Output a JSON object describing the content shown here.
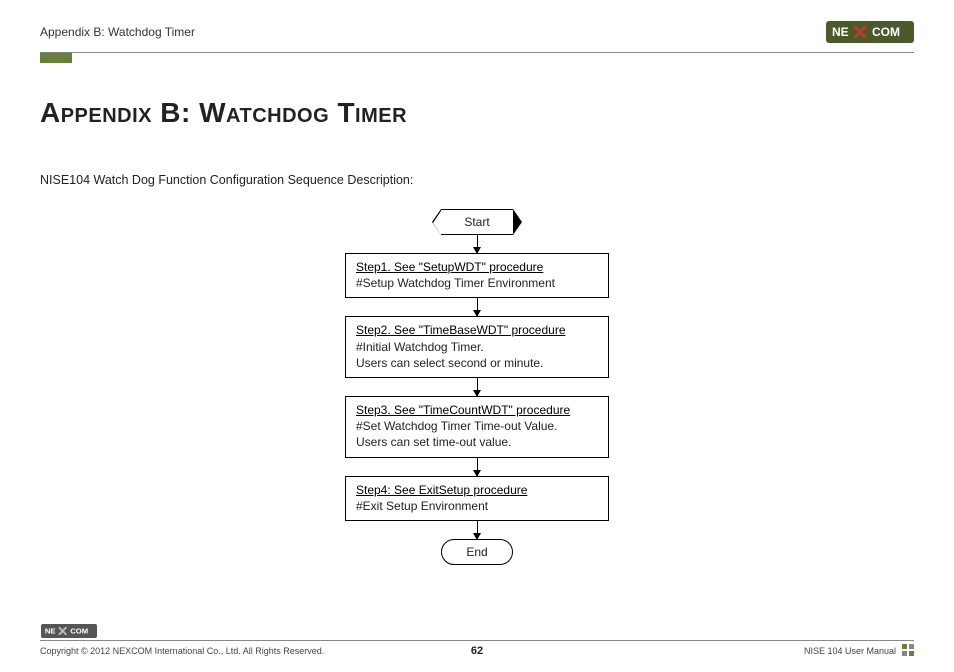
{
  "header": {
    "breadcrumb": "Appendix B: Watchdog Timer",
    "logo_text_left": "NE",
    "logo_text_right": "COM"
  },
  "title": "Appendix B: Watchdog Timer",
  "intro": "NISE104 Watch Dog Function Configuration Sequence Description:",
  "flow": {
    "start": "Start",
    "end": "End",
    "steps": [
      {
        "link": "Step1. See \"SetupWDT\" procedure",
        "desc": "#Setup Watchdog Timer Environment"
      },
      {
        "link": "Step2. See \"TimeBaseWDT\" procedure",
        "desc": "#Initial Watchdog Timer.\n Users can select second or minute."
      },
      {
        "link": "Step3. See \"TimeCountWDT\" procedure",
        "desc": "#Set Watchdog Timer Time-out Value.\nUsers can set time-out value."
      },
      {
        "link": "Step4: See ExitSetup procedure",
        "desc": "#Exit Setup Environment"
      }
    ]
  },
  "footer": {
    "copyright": "Copyright © 2012 NEXCOM International Co., Ltd. All Rights Reserved.",
    "page_number": "62",
    "manual": "NISE 104 User Manual"
  },
  "chart_data": {
    "type": "flowchart",
    "direction": "top-to-bottom",
    "nodes": [
      {
        "id": "start",
        "shape": "terminator-hex",
        "label": "Start"
      },
      {
        "id": "s1",
        "shape": "process",
        "title": "Step1. See \"SetupWDT\" procedure",
        "body": "#Setup Watchdog Timer Environment"
      },
      {
        "id": "s2",
        "shape": "process",
        "title": "Step2. See \"TimeBaseWDT\" procedure",
        "body": "#Initial Watchdog Timer. Users can select second or minute."
      },
      {
        "id": "s3",
        "shape": "process",
        "title": "Step3. See \"TimeCountWDT\" procedure",
        "body": "#Set Watchdog Timer Time-out Value. Users can set time-out value."
      },
      {
        "id": "s4",
        "shape": "process",
        "title": "Step4: See ExitSetup procedure",
        "body": "#Exit Setup Environment"
      },
      {
        "id": "end",
        "shape": "terminator-round",
        "label": "End"
      }
    ],
    "edges": [
      {
        "from": "start",
        "to": "s1"
      },
      {
        "from": "s1",
        "to": "s2"
      },
      {
        "from": "s2",
        "to": "s3"
      },
      {
        "from": "s3",
        "to": "s4"
      },
      {
        "from": "s4",
        "to": "end"
      }
    ]
  }
}
